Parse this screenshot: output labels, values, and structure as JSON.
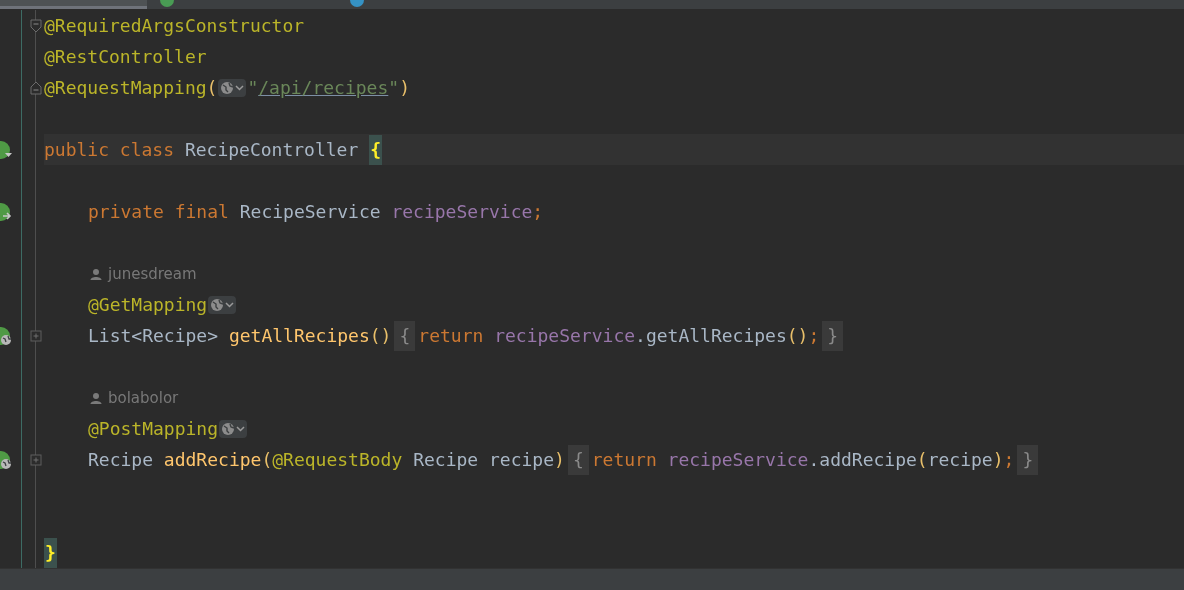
{
  "tabs": [
    {
      "selected": true
    },
    {
      "selected": false,
      "color": "#499c54"
    },
    {
      "selected": false,
      "color": "#3592c4"
    }
  ],
  "lines": [
    {
      "fold": {
        "kind": "start"
      },
      "tokens": [
        {
          "kind": "annotation",
          "text": "@RequiredArgsConstructor"
        }
      ]
    },
    {
      "tokens": [
        {
          "kind": "annotation",
          "text": "@RestController"
        }
      ]
    },
    {
      "fold": {
        "kind": "end"
      },
      "blank_after": true,
      "tokens": [
        {
          "kind": "annotation",
          "text": "@RequestMapping"
        },
        {
          "kind": "paren",
          "text": "("
        },
        {
          "kind": "globe"
        },
        {
          "kind": "string",
          "text": "\""
        },
        {
          "kind": "link",
          "text": "/api/recipes"
        },
        {
          "kind": "string",
          "text": "\""
        },
        {
          "kind": "paren",
          "text": ")"
        }
      ]
    },
    {
      "current": true,
      "gutter": {
        "kind": "class"
      },
      "blank_after": true,
      "tokens": [
        {
          "kind": "keyword",
          "text": "public class "
        },
        {
          "kind": "plain",
          "text": "RecipeController "
        },
        {
          "kind": "matched-brace",
          "text": "{"
        }
      ]
    },
    {
      "indented": true,
      "gutter": {
        "kind": "field"
      },
      "blank_after": true,
      "tokens": [
        {
          "kind": "keyword",
          "text": "private final "
        },
        {
          "kind": "plain",
          "text": "RecipeService "
        },
        {
          "kind": "field",
          "text": "recipeService"
        },
        {
          "kind": "keyword",
          "text": ";"
        }
      ]
    },
    {
      "indented": true,
      "tokens": [
        {
          "kind": "author",
          "text": "junesdream"
        }
      ]
    },
    {
      "indented": true,
      "tokens": [
        {
          "kind": "annotation",
          "text": "@GetMapping"
        },
        {
          "kind": "globe"
        }
      ]
    },
    {
      "indented": true,
      "gutter": {
        "kind": "method"
      },
      "fold": {
        "kind": "collapsed"
      },
      "blank_after": true,
      "tokens": [
        {
          "kind": "plain",
          "text": "List<Recipe> "
        },
        {
          "kind": "method",
          "text": "getAllRecipes"
        },
        {
          "kind": "paren",
          "text": "()"
        },
        {
          "kind": "folded-brace",
          "text": "{"
        },
        {
          "kind": "keyword",
          "text": "return "
        },
        {
          "kind": "field",
          "text": "recipeService"
        },
        {
          "kind": "plain",
          "text": ".getAllRecipes"
        },
        {
          "kind": "paren",
          "text": "()"
        },
        {
          "kind": "keyword",
          "text": ";"
        },
        {
          "kind": "folded-brace",
          "text": "}"
        }
      ]
    },
    {
      "indented": true,
      "tokens": [
        {
          "kind": "author",
          "text": "bolabolor"
        }
      ]
    },
    {
      "indented": true,
      "tokens": [
        {
          "kind": "annotation",
          "text": "@PostMapping"
        },
        {
          "kind": "globe"
        }
      ]
    },
    {
      "indented": true,
      "gutter": {
        "kind": "method"
      },
      "fold": {
        "kind": "collapsed"
      },
      "blank_after": true,
      "tokens": [
        {
          "kind": "plain",
          "text": "Recipe "
        },
        {
          "kind": "method",
          "text": "addRecipe"
        },
        {
          "kind": "paren",
          "text": "("
        },
        {
          "kind": "annotation",
          "text": "@RequestBody "
        },
        {
          "kind": "plain",
          "text": "Recipe recipe"
        },
        {
          "kind": "paren",
          "text": ")"
        },
        {
          "kind": "folded-brace",
          "text": "{"
        },
        {
          "kind": "keyword",
          "text": "return "
        },
        {
          "kind": "field",
          "text": "recipeService"
        },
        {
          "kind": "plain",
          "text": ".addRecipe"
        },
        {
          "kind": "paren",
          "text": "("
        },
        {
          "kind": "plain",
          "text": "recipe"
        },
        {
          "kind": "paren",
          "text": ")"
        },
        {
          "kind": "keyword",
          "text": ";"
        },
        {
          "kind": "folded-brace",
          "text": "}"
        }
      ]
    },
    {
      "blank_before": true,
      "tokens": [
        {
          "kind": "matched-brace",
          "text": "}"
        }
      ]
    }
  ]
}
